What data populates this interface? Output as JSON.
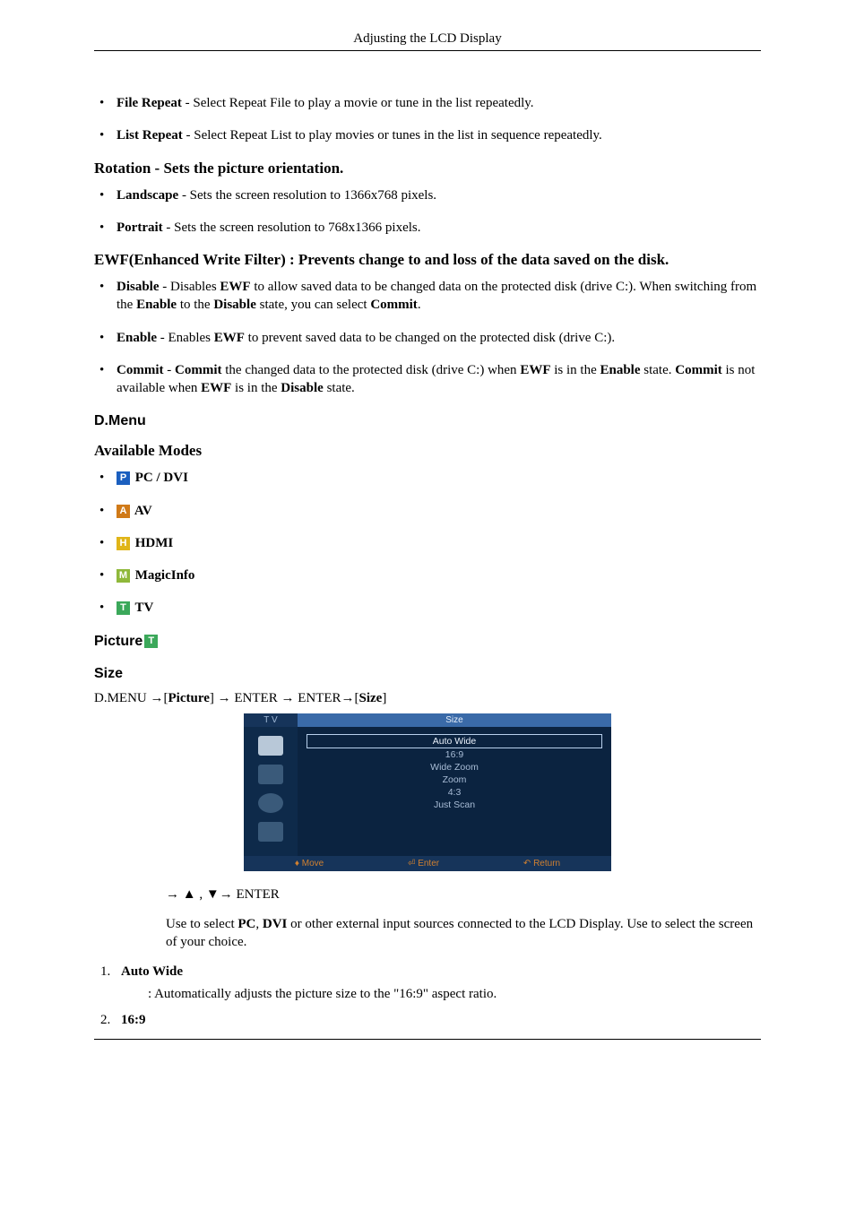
{
  "header": {
    "title": "Adjusting the LCD Display"
  },
  "fileRepeat": {
    "label": "File Repeat",
    "desc": " - Select Repeat File to play a movie or tune in the list repeatedly."
  },
  "listRepeat": {
    "label": "List Repeat",
    "desc": " - Select Repeat List to play movies or tunes in the list in sequence repeatedly."
  },
  "rotation": {
    "heading": "Rotation - Sets the picture orientation.",
    "landscape_label": "Landscape",
    "landscape_desc": " - Sets the screen resolution to 1366x768 pixels.",
    "portrait_label": "Portrait",
    "portrait_desc": " - Sets the screen resolution to 768x1366 pixels."
  },
  "ewf": {
    "heading": "EWF(Enhanced Write Filter) : Prevents change to and loss of the data saved on the disk.",
    "disable_label": "Disable",
    "disable_1": " - Disables ",
    "disable_ewf": "EWF",
    "disable_2": " to allow saved data to be changed data on the protected disk (drive C:). When switching from the ",
    "disable_enable": "Enable",
    "disable_3": " to the ",
    "disable_disable": "Disable",
    "disable_4": " state, you can select ",
    "disable_commit": "Commit",
    "disable_5": ".",
    "enable_label": "Enable",
    "enable_1": " - Enables ",
    "enable_ewf": "EWF",
    "enable_2": " to prevent saved data to be changed on the protected disk (drive C:).",
    "commit_label": "Commit",
    "commit_1": " - ",
    "commit_b1": "Commit",
    "commit_2": " the changed data to the protected disk (drive C:) when ",
    "commit_ewf": "EWF",
    "commit_3": " is in the ",
    "commit_enable": "Enable",
    "commit_4": " state. ",
    "commit_b2": "Commit",
    "commit_5": " is not available when ",
    "commit_ewf2": "EWF",
    "commit_6": " is in the ",
    "commit_disable": "Disable",
    "commit_7": " state."
  },
  "dmenu": {
    "heading": "D.Menu",
    "avail_heading": "Available Modes",
    "modes": {
      "p_glyph": "P",
      "p_label": " PC / DVI",
      "a_glyph": "A",
      "a_label": " AV",
      "h_glyph": "H",
      "h_label": " HDMI",
      "m_glyph": "M",
      "m_label": " MagicInfo",
      "t_glyph": "T",
      "t_label": " TV"
    }
  },
  "picture": {
    "heading": "Picture",
    "t_glyph": "T"
  },
  "size": {
    "heading": "Size",
    "path_1": "D.MENU →[",
    "path_pic": "Picture",
    "path_2": "] → ENTER → ENTER→[",
    "path_size": "Size",
    "path_3": "]",
    "arrows": "→ ▲ , ▼→ ENTER",
    "desc_1": "Use to select ",
    "desc_pc": "PC",
    "desc_2": ", ",
    "desc_dvi": "DVI",
    "desc_3": " or other external input sources connected to the LCD Display. Use to select the screen of your choice.",
    "item1_label": "Auto Wide",
    "item1_desc": ": Automatically adjusts the picture size to the \"16:9\" aspect ratio.",
    "item2_label": "16:9"
  },
  "osd": {
    "tab_left": "T V",
    "tab_right": "Size",
    "list": [
      "Auto Wide",
      "16:9",
      "Wide Zoom",
      "Zoom",
      "4:3",
      "Just Scan"
    ],
    "bottom_move": "Move",
    "bottom_enter": "Enter",
    "bottom_return": "Return"
  }
}
